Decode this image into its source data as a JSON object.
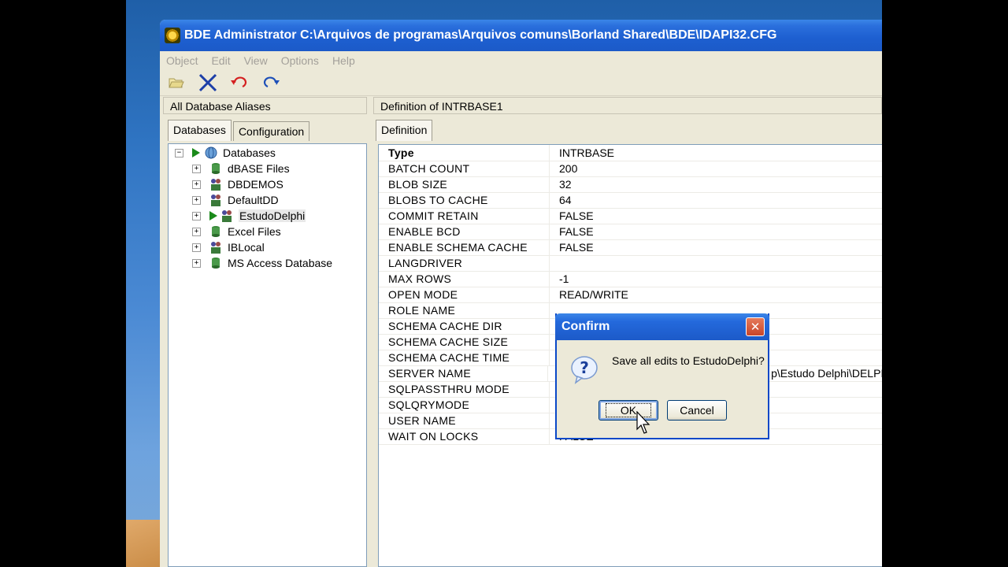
{
  "window": {
    "title": "BDE Administrator  C:\\Arquivos de programas\\Arquivos comuns\\Borland Shared\\BDE\\IDAPI32.CFG"
  },
  "menu": [
    "Object",
    "Edit",
    "View",
    "Options",
    "Help"
  ],
  "toolbar": {
    "icons": [
      "open-folder-icon",
      "delete-x-icon",
      "undo-icon",
      "redo-icon"
    ]
  },
  "left_panel": {
    "header": "All Database Aliases",
    "tabs": [
      "Databases",
      "Configuration"
    ],
    "tree_root": "Databases",
    "tree_items": [
      "dBASE Files",
      "DBDEMOS",
      "DefaultDD",
      "EstudoDelphi",
      "Excel Files",
      "IBLocal",
      "MS Access Database"
    ],
    "selected": "EstudoDelphi"
  },
  "right_panel": {
    "header": "Definition of INTRBASE1",
    "tab": "Definition",
    "rows": [
      {
        "key": "Type",
        "value": "INTRBASE"
      },
      {
        "key": "BATCH COUNT",
        "value": "200"
      },
      {
        "key": "BLOB SIZE",
        "value": "32"
      },
      {
        "key": "BLOBS TO CACHE",
        "value": "64"
      },
      {
        "key": "COMMIT RETAIN",
        "value": "FALSE"
      },
      {
        "key": "ENABLE BCD",
        "value": "FALSE"
      },
      {
        "key": "ENABLE SCHEMA CACHE",
        "value": "FALSE"
      },
      {
        "key": "LANGDRIVER",
        "value": ""
      },
      {
        "key": "MAX ROWS",
        "value": "-1"
      },
      {
        "key": "OPEN MODE",
        "value": "READ/WRITE"
      },
      {
        "key": "ROLE NAME",
        "value": ""
      },
      {
        "key": "SCHEMA CACHE DIR",
        "value": ""
      },
      {
        "key": "SCHEMA CACHE SIZE",
        "value": ""
      },
      {
        "key": "SCHEMA CACHE TIME",
        "value": ""
      },
      {
        "key": "SERVER NAME",
        "value": "p\\Estudo Delphi\\DELPI"
      },
      {
        "key": "SQLPASSTHRU MODE",
        "value": ""
      },
      {
        "key": "SQLQRYMODE",
        "value": ""
      },
      {
        "key": "USER NAME",
        "value": ""
      },
      {
        "key": "WAIT ON LOCKS",
        "value": "FALSE"
      }
    ]
  },
  "dialog": {
    "title": "Confirm",
    "message": "Save all edits to EstudoDelphi?",
    "ok_label": "OK",
    "cancel_label": "Cancel",
    "close_glyph": "✕"
  }
}
